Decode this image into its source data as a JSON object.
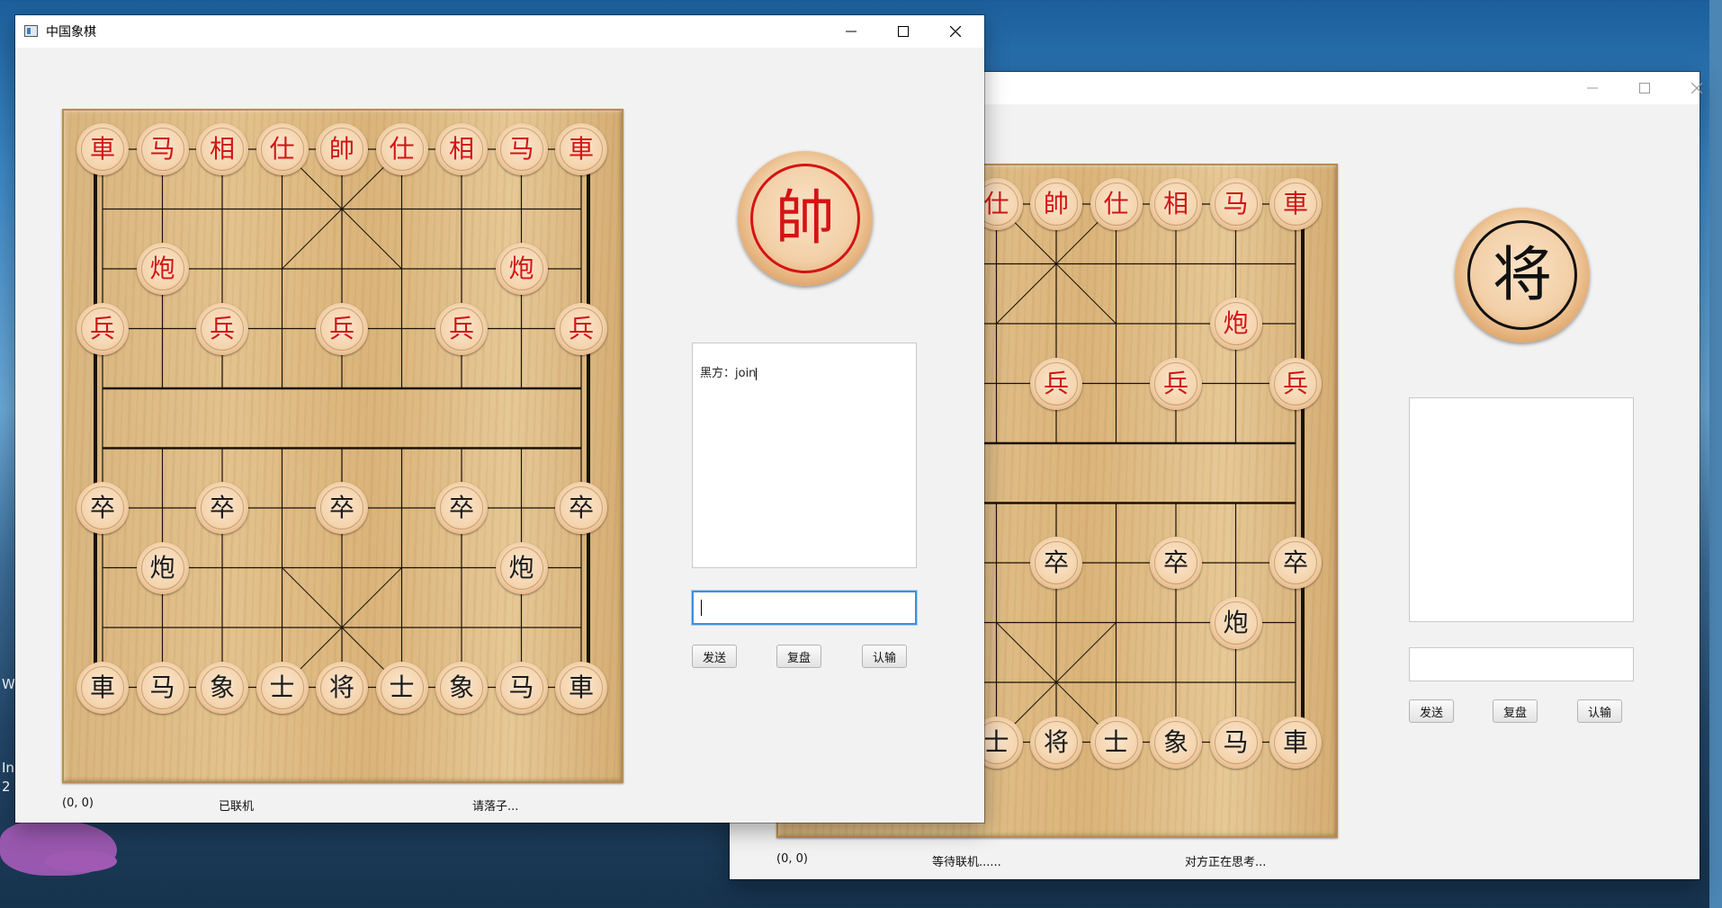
{
  "desktop": {
    "fragments": [
      "W",
      "In",
      "2"
    ]
  },
  "window1": {
    "title": "中国象棋",
    "big_piece": {
      "char": "帥",
      "color": "red"
    },
    "chat_log": "黑方：join",
    "chat_input_value": "",
    "buttons": {
      "send": "发送",
      "replay": "复盘",
      "resign": "认输"
    },
    "status": {
      "coord": "(0, 0)",
      "connection": "已联机",
      "turn": "请落子..."
    },
    "pieces": [
      {
        "c": 0,
        "r": 0,
        "t": "車",
        "color": "red"
      },
      {
        "c": 1,
        "r": 0,
        "t": "马",
        "color": "red"
      },
      {
        "c": 2,
        "r": 0,
        "t": "相",
        "color": "red"
      },
      {
        "c": 3,
        "r": 0,
        "t": "仕",
        "color": "red"
      },
      {
        "c": 4,
        "r": 0,
        "t": "帥",
        "color": "red"
      },
      {
        "c": 5,
        "r": 0,
        "t": "仕",
        "color": "red"
      },
      {
        "c": 6,
        "r": 0,
        "t": "相",
        "color": "red"
      },
      {
        "c": 7,
        "r": 0,
        "t": "马",
        "color": "red"
      },
      {
        "c": 8,
        "r": 0,
        "t": "車",
        "color": "red"
      },
      {
        "c": 1,
        "r": 2,
        "t": "炮",
        "color": "red"
      },
      {
        "c": 7,
        "r": 2,
        "t": "炮",
        "color": "red"
      },
      {
        "c": 0,
        "r": 3,
        "t": "兵",
        "color": "red"
      },
      {
        "c": 2,
        "r": 3,
        "t": "兵",
        "color": "red"
      },
      {
        "c": 4,
        "r": 3,
        "t": "兵",
        "color": "red"
      },
      {
        "c": 6,
        "r": 3,
        "t": "兵",
        "color": "red"
      },
      {
        "c": 8,
        "r": 3,
        "t": "兵",
        "color": "red"
      },
      {
        "c": 0,
        "r": 6,
        "t": "卒",
        "color": "black"
      },
      {
        "c": 2,
        "r": 6,
        "t": "卒",
        "color": "black"
      },
      {
        "c": 4,
        "r": 6,
        "t": "卒",
        "color": "black"
      },
      {
        "c": 6,
        "r": 6,
        "t": "卒",
        "color": "black"
      },
      {
        "c": 8,
        "r": 6,
        "t": "卒",
        "color": "black"
      },
      {
        "c": 1,
        "r": 7,
        "t": "炮",
        "color": "black"
      },
      {
        "c": 7,
        "r": 7,
        "t": "炮",
        "color": "black"
      },
      {
        "c": 0,
        "r": 9,
        "t": "車",
        "color": "black"
      },
      {
        "c": 1,
        "r": 9,
        "t": "马",
        "color": "black"
      },
      {
        "c": 2,
        "r": 9,
        "t": "象",
        "color": "black"
      },
      {
        "c": 3,
        "r": 9,
        "t": "士",
        "color": "black"
      },
      {
        "c": 4,
        "r": 9,
        "t": "将",
        "color": "black"
      },
      {
        "c": 5,
        "r": 9,
        "t": "士",
        "color": "black"
      },
      {
        "c": 6,
        "r": 9,
        "t": "象",
        "color": "black"
      },
      {
        "c": 7,
        "r": 9,
        "t": "马",
        "color": "black"
      },
      {
        "c": 8,
        "r": 9,
        "t": "車",
        "color": "black"
      }
    ]
  },
  "window2": {
    "title": "",
    "big_piece": {
      "char": "将",
      "color": "black"
    },
    "chat_log": "",
    "chat_input_value": "",
    "buttons": {
      "send": "发送",
      "replay": "复盘",
      "resign": "认输"
    },
    "status": {
      "coord": "(0, 0)",
      "connection": "等待联机......",
      "turn": "对方正在思考..."
    },
    "pieces": [
      {
        "c": 3,
        "r": 0,
        "t": "仕",
        "color": "red"
      },
      {
        "c": 4,
        "r": 0,
        "t": "帥",
        "color": "red"
      },
      {
        "c": 5,
        "r": 0,
        "t": "仕",
        "color": "red"
      },
      {
        "c": 6,
        "r": 0,
        "t": "相",
        "color": "red"
      },
      {
        "c": 7,
        "r": 0,
        "t": "马",
        "color": "red"
      },
      {
        "c": 8,
        "r": 0,
        "t": "車",
        "color": "red"
      },
      {
        "c": 7,
        "r": 2,
        "t": "炮",
        "color": "red"
      },
      {
        "c": 4,
        "r": 3,
        "t": "兵",
        "color": "red"
      },
      {
        "c": 6,
        "r": 3,
        "t": "兵",
        "color": "red"
      },
      {
        "c": 8,
        "r": 3,
        "t": "兵",
        "color": "red"
      },
      {
        "c": 4,
        "r": 6,
        "t": "卒",
        "color": "black"
      },
      {
        "c": 6,
        "r": 6,
        "t": "卒",
        "color": "black"
      },
      {
        "c": 8,
        "r": 6,
        "t": "卒",
        "color": "black"
      },
      {
        "c": 7,
        "r": 7,
        "t": "炮",
        "color": "black"
      },
      {
        "c": 3,
        "r": 9,
        "t": "士",
        "color": "black"
      },
      {
        "c": 4,
        "r": 9,
        "t": "将",
        "color": "black"
      },
      {
        "c": 5,
        "r": 9,
        "t": "士",
        "color": "black"
      },
      {
        "c": 6,
        "r": 9,
        "t": "象",
        "color": "black"
      },
      {
        "c": 7,
        "r": 9,
        "t": "马",
        "color": "black"
      },
      {
        "c": 8,
        "r": 9,
        "t": "車",
        "color": "black"
      }
    ]
  }
}
